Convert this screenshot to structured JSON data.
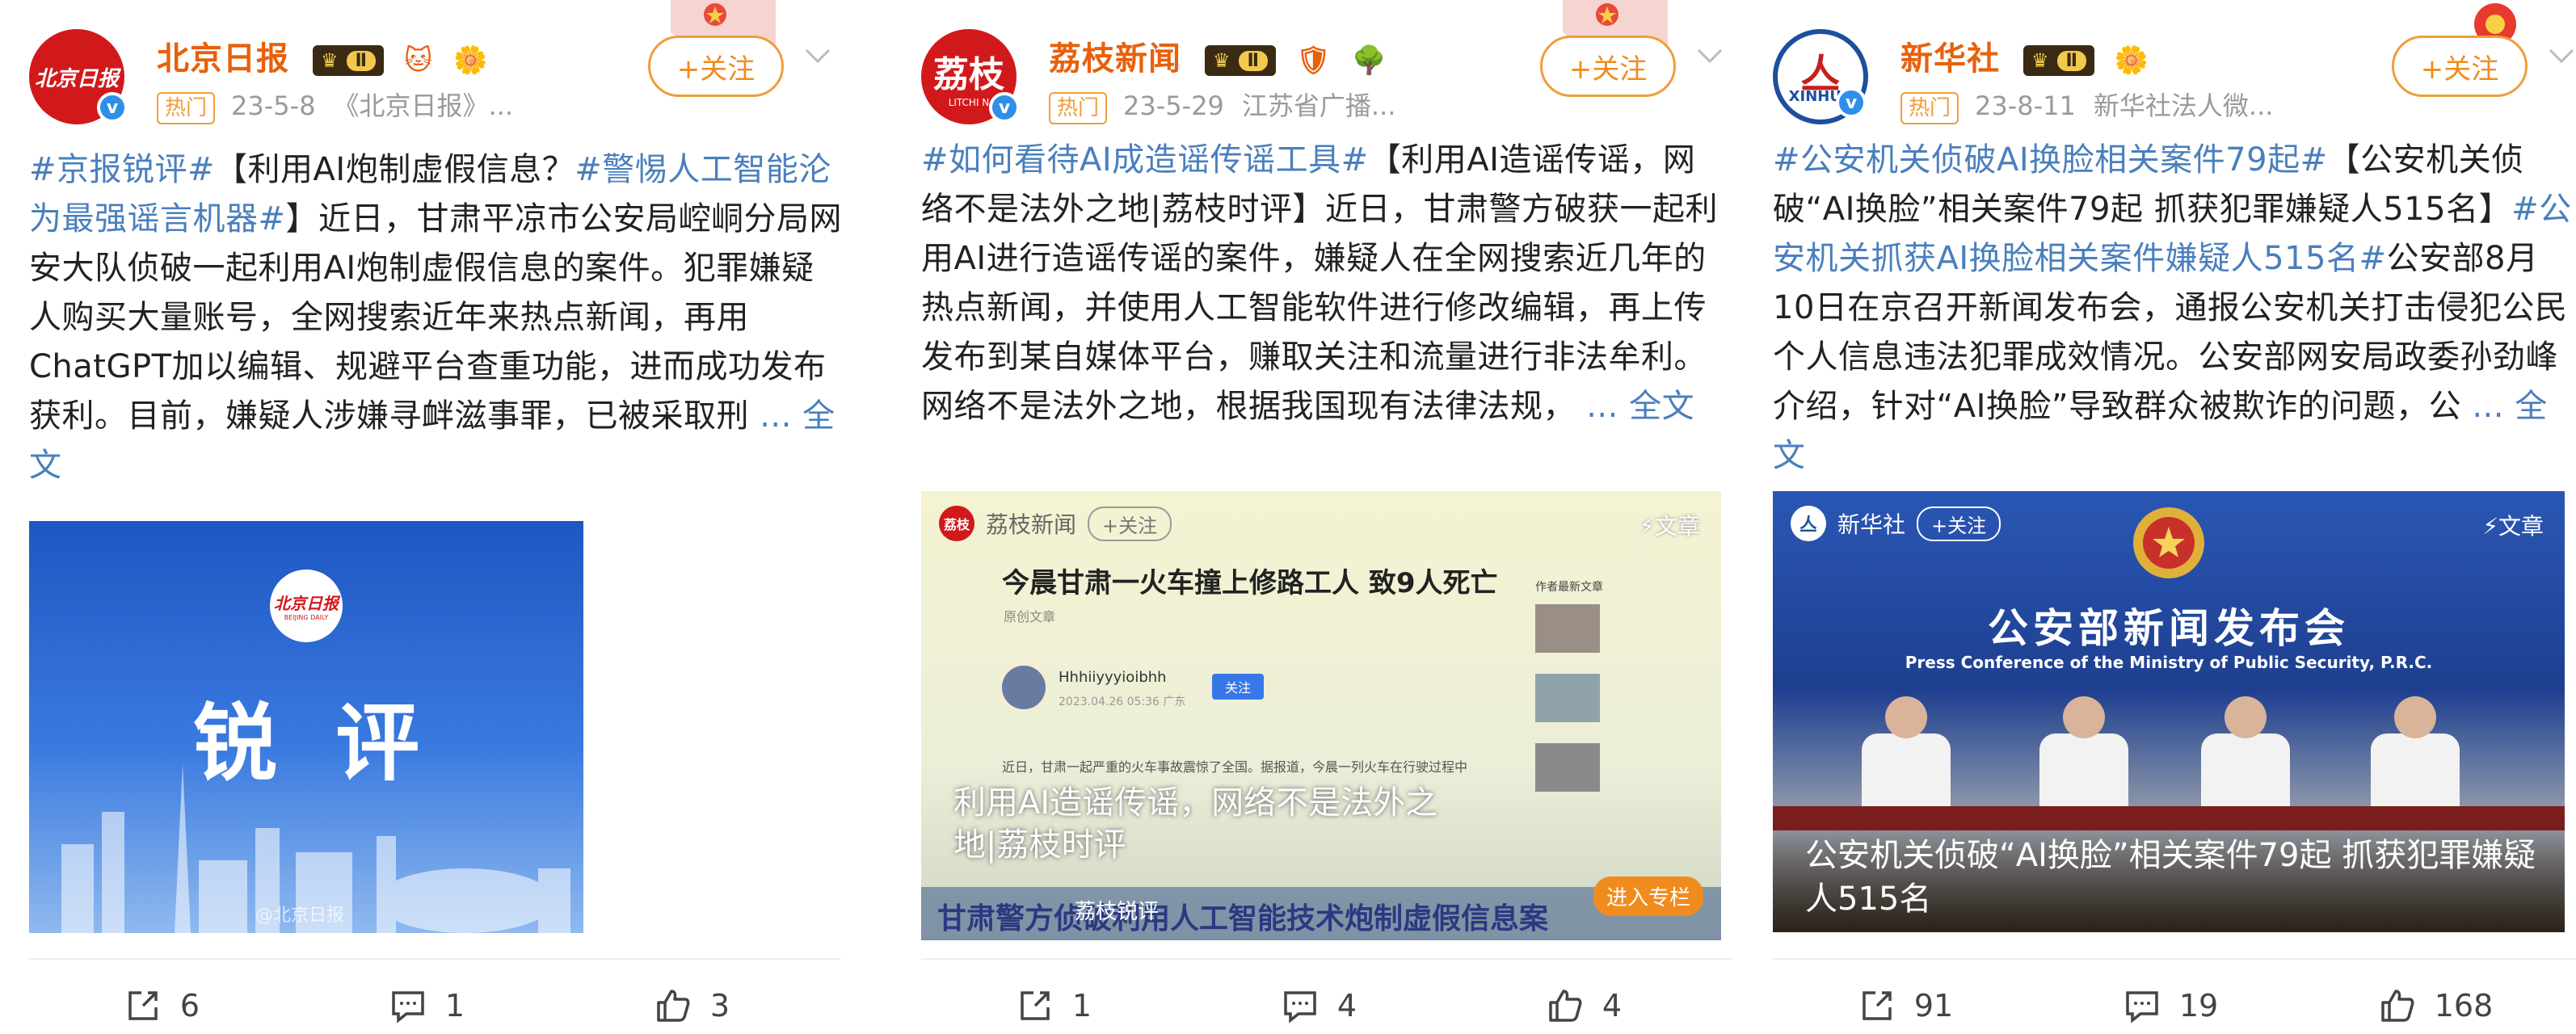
{
  "colors": {
    "brand_orange": "#e8600c",
    "topic_blue": "#4a7fbd",
    "hot_orange": "#f09d3a"
  },
  "posts": [
    {
      "author": "北京日报",
      "avatar_text": "北京日报",
      "level": "Ⅱ",
      "hot_tag": "热门",
      "date": "23-5-8",
      "source": "《北京日报》...",
      "follow_label": "+关注",
      "text_segments": [
        {
          "type": "topic",
          "text": "#京报锐评#"
        },
        {
          "type": "plain",
          "text": "【利用AI炮制虚假信息？"
        },
        {
          "type": "topic",
          "text": "#警惕人工智能沦为最强谣言机器#"
        },
        {
          "type": "plain",
          "text": "】近日，甘肃平凉市公安局崆峒分局网安大队侦破一起利用AI炮制虚假信息的案件。犯罪嫌疑人购买大量账号，全网搜索近年来热点新闻，再用ChatGPT加以编辑、规避平台查重功能，进而成功发布获利。目前，嫌疑人涉嫌寻衅滋事罪，已被采取刑 "
        },
        {
          "type": "more",
          "text": "... 全文"
        }
      ],
      "image": {
        "logo_text": "北京日报",
        "logo_sub": "BEIJING DAILY",
        "headline": "锐  评",
        "watermark": "@北京日报"
      },
      "actions": {
        "repost": "6",
        "comment": "1",
        "like": "3"
      }
    },
    {
      "author": "荔枝新闻",
      "avatar_text": "荔枝",
      "avatar_sub": "LITCHI N",
      "level": "Ⅱ",
      "hot_tag": "热门",
      "date": "23-5-29",
      "source": "江苏省广播...",
      "follow_label": "+关注",
      "text_segments": [
        {
          "type": "topic",
          "text": "#如何看待AI成造谣传谣工具#"
        },
        {
          "type": "plain",
          "text": "【利用AI造谣传谣，网络不是法外之地|荔枝时评】近日，甘肃警方破获一起利用AI进行造谣传谣的案件，嫌疑人在全网搜索近几年的热点新闻，并使用人工智能软件进行修改编辑，再上传发布到某自媒体平台，赚取关注和流量进行非法牟利。网络不是法外之地，根据我国现有法律法规， "
        },
        {
          "type": "more",
          "text": "... 全文"
        }
      ],
      "image": {
        "brand_logo": "荔枝",
        "brand_name": "荔枝新闻",
        "brand_follow": "+关注",
        "article_tag": "文章",
        "inner_title": "今晨甘肃一火车撞上修路工人 致9人死亡",
        "inner_sub": "原创文章",
        "inner_user": "Hhhiiyyyioibhh",
        "inner_time": "2023.04.26 05:36 广东",
        "inner_follow": "关注",
        "inner_side_title": "作者最新文章",
        "inner_body": "近日，甘肃一起严重的火车事故震惊了全国。据报道，今晨一列火车在行驶过程中",
        "overlay_caption": "利用AI造谣传谣，网络不是法外之地|荔枝时评",
        "bottom_banner": "甘肃警方侦破利用人工智能技术炮制虚假信息案",
        "bottom_source": "荔枝锐评",
        "column_button": "进入专栏"
      },
      "actions": {
        "repost": "1",
        "comment": "4",
        "like": "4"
      }
    },
    {
      "author": "新华社",
      "avatar_sub": "XINHUA",
      "level": "Ⅱ",
      "hot_tag": "热门",
      "date": "23-8-11",
      "source": "新华社法人微...",
      "follow_label": "+关注",
      "text_segments": [
        {
          "type": "topic",
          "text": "#公安机关侦破AI换脸相关案件79起#"
        },
        {
          "type": "plain",
          "text": "【公安机关侦破“AI换脸”相关案件79起 抓获犯罪嫌疑人515名】"
        },
        {
          "type": "topic",
          "text": "#公安机关抓获AI换脸相关案件嫌疑人515名#"
        },
        {
          "type": "plain",
          "text": "公安部8月10日在京召开新闻发布会，通报公安机关打击侵犯公民个人信息违法犯罪成效情况。公安部网安局政委孙劲峰介绍，针对“AI换脸”导致群众被欺诈的问题，公 "
        },
        {
          "type": "more",
          "text": "... 全文"
        }
      ],
      "image": {
        "brand_name": "新华社",
        "brand_follow": "+关注",
        "article_tag": "文章",
        "backdrop_title": "公安部新闻发布会",
        "backdrop_en": "Press Conference of the Ministry of Public Security, P.R.C.",
        "caption": "公安机关侦破“AI换脸”相关案件79起 抓获犯罪嫌疑人515名"
      },
      "actions": {
        "repost": "91",
        "comment": "19",
        "like": "168"
      }
    }
  ]
}
